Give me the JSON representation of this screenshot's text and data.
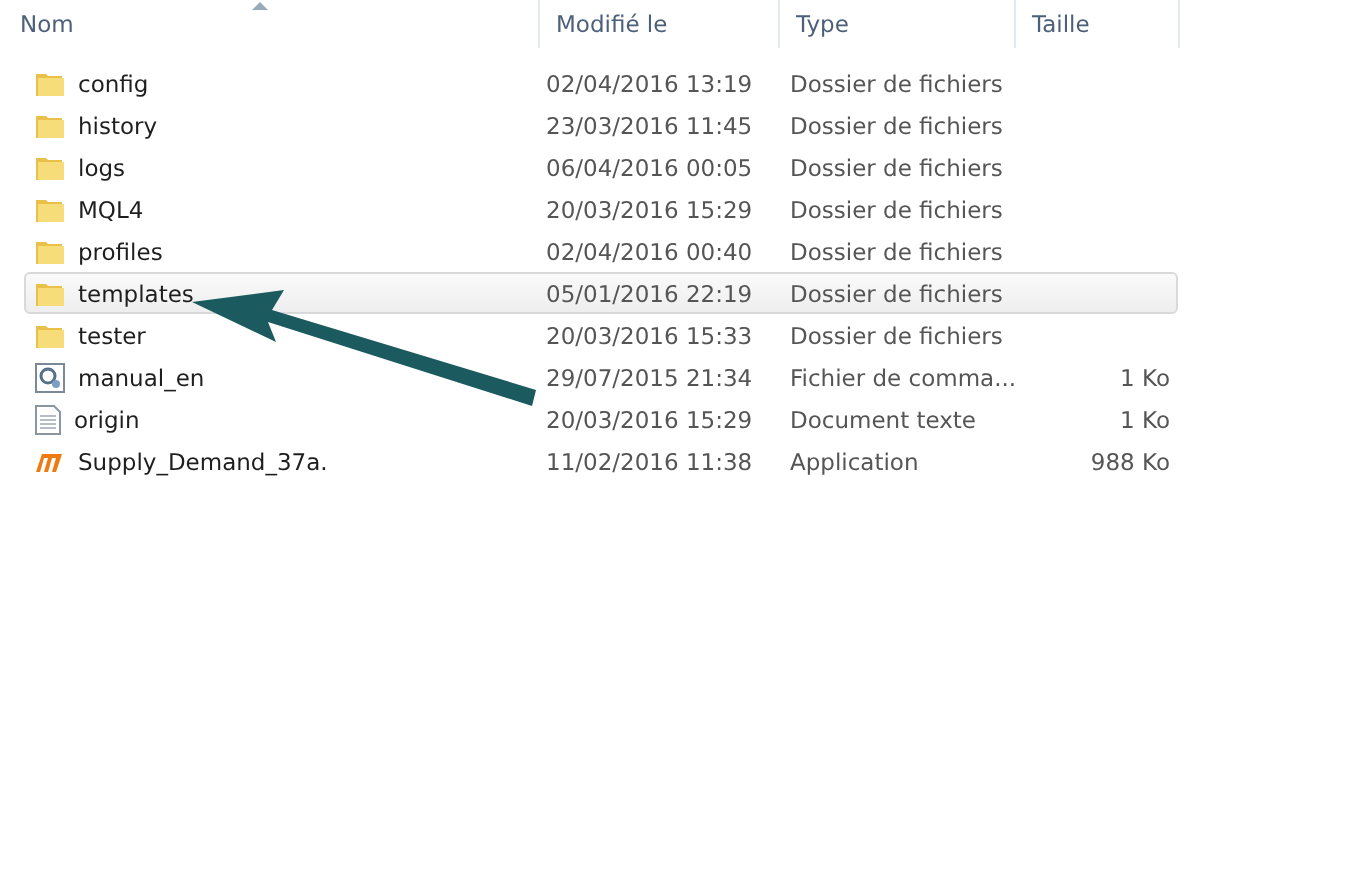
{
  "columns": [
    {
      "label": "Nom",
      "sorted": true
    },
    {
      "label": "Modifié le",
      "sorted": false
    },
    {
      "label": "Type",
      "sorted": false
    },
    {
      "label": "Taille",
      "sorted": false
    }
  ],
  "rows": [
    {
      "kind": "folder",
      "name": "config",
      "modified": "02/04/2016 13:19",
      "type": "Dossier de fichiers",
      "selected": false
    },
    {
      "kind": "folder",
      "name": "history",
      "modified": "23/03/2016 11:45",
      "type": "Dossier de fichiers",
      "selected": false
    },
    {
      "kind": "folder",
      "name": "logs",
      "modified": "06/04/2016 00:05",
      "type": "Dossier de fichiers",
      "selected": false
    },
    {
      "kind": "folder",
      "name": "MQL4",
      "modified": "20/03/2016 15:29",
      "type": "Dossier de fichiers",
      "selected": false
    },
    {
      "kind": "folder",
      "name": "profiles",
      "modified": "02/04/2016 00:40",
      "type": "Dossier de fichiers",
      "selected": false
    },
    {
      "kind": "folder",
      "name": "templates",
      "modified": "05/01/2016 22:19",
      "type": "Dossier de fichiers",
      "selected": true
    },
    {
      "kind": "folder",
      "name": "tester",
      "modified": "20/03/2016 15:33",
      "type": "Dossier de fichiers",
      "selected": false
    },
    {
      "kind": "script",
      "name": "manual_en",
      "modified": "29/07/2015 21:34",
      "type": "Fichier de comma...",
      "size": "1 Ko",
      "selected": false
    },
    {
      "kind": "text",
      "name": "origin",
      "modified": "20/03/2016 15:29",
      "type": "Document texte",
      "size": "1 Ko",
      "selected": false
    },
    {
      "kind": "app",
      "name": "Supply_Demand_37a.",
      "modified": "11/02/2016 11:38",
      "type": "Application",
      "size": "988 Ko",
      "selected": false
    }
  ]
}
